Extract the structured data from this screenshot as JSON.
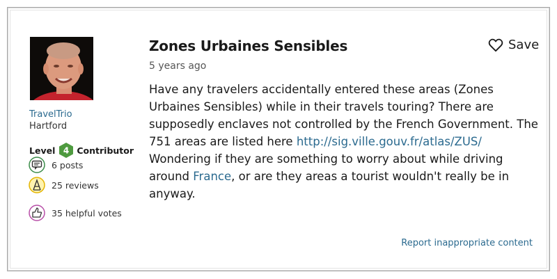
{
  "post": {
    "title": "Zones Urbaines Sensibles",
    "time_ago": "5 years ago",
    "save_label": "Save",
    "body": {
      "part1": "Have any travelers accidentally entered these areas (Zones Urbaines Sensibles) while in their travels touring? There are supposedly enclaves not controlled by the French Government. The 751 areas are listed here ",
      "link1": "http://sig.ville.gouv.fr/atlas/ZUS/",
      "part2": " Wondering if they are something to worry about while driving around ",
      "link2": "France",
      "part3": ", or are they areas a tourist wouldn't really be in anyway."
    },
    "report_label": "Report inappropriate content"
  },
  "author": {
    "username": "TravelTrio",
    "hometown": "Hartford",
    "level_prefix": "Level",
    "level_number": "4",
    "level_suffix": "Contributor",
    "stats": [
      {
        "label": "6 posts",
        "icon": "posts-icon"
      },
      {
        "label": "25 reviews",
        "icon": "reviews-icon"
      },
      {
        "label": "35 helpful votes",
        "icon": "helpful-votes-icon"
      }
    ]
  },
  "colors": {
    "link": "#2b6a8f",
    "level_badge": "#4e9a3f",
    "icon_posts": "#3c8c4a",
    "icon_reviews": "#e3b400",
    "icon_helpful": "#b84fa8"
  }
}
